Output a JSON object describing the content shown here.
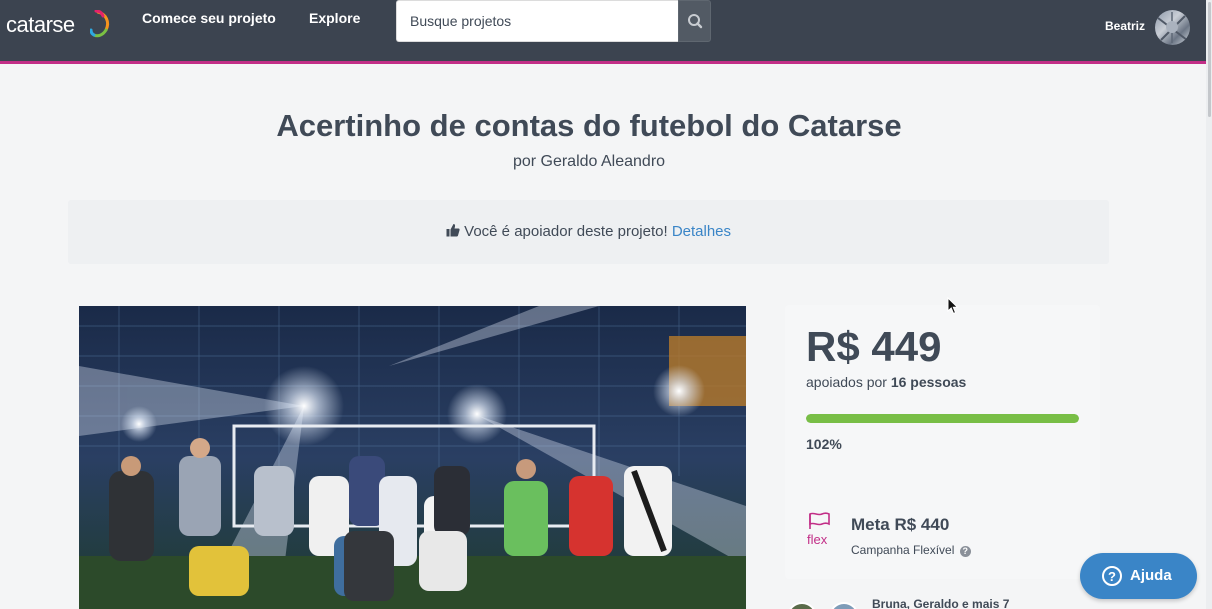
{
  "header": {
    "logo": "catarse",
    "nav": {
      "start_project": "Comece seu projeto",
      "explore": "Explore"
    },
    "search": {
      "placeholder": "Busque projetos",
      "value": ""
    },
    "user": {
      "name": "Beatriz"
    }
  },
  "project": {
    "title": "Acertinho de contas do futebol do Catarse",
    "byline": "por Geraldo Aleandro"
  },
  "banner": {
    "text": "Você é apoiador deste projeto!",
    "link": "Detalhes"
  },
  "stats": {
    "amount": "R$ 449",
    "backed_prefix": "apoiados por",
    "backers": "16 pessoas",
    "progress_percent": 102,
    "percent_label": "102%",
    "flex_label": "flex",
    "goal": "Meta R$ 440",
    "campaign_type": "Campanha Flexível"
  },
  "supporters": {
    "text": "Bruna, Geraldo e mais 7"
  },
  "help": {
    "label": "Ajuda"
  },
  "colors": {
    "header_bg": "#3c4450",
    "accent_magenta": "#c22e87",
    "link_blue": "#3a85c7",
    "progress_green": "#78be46"
  },
  "icons": {
    "search": "search-icon",
    "thumbs_up": "thumbs-up-icon",
    "flex": "flag-icon",
    "help": "question-circle-icon"
  }
}
